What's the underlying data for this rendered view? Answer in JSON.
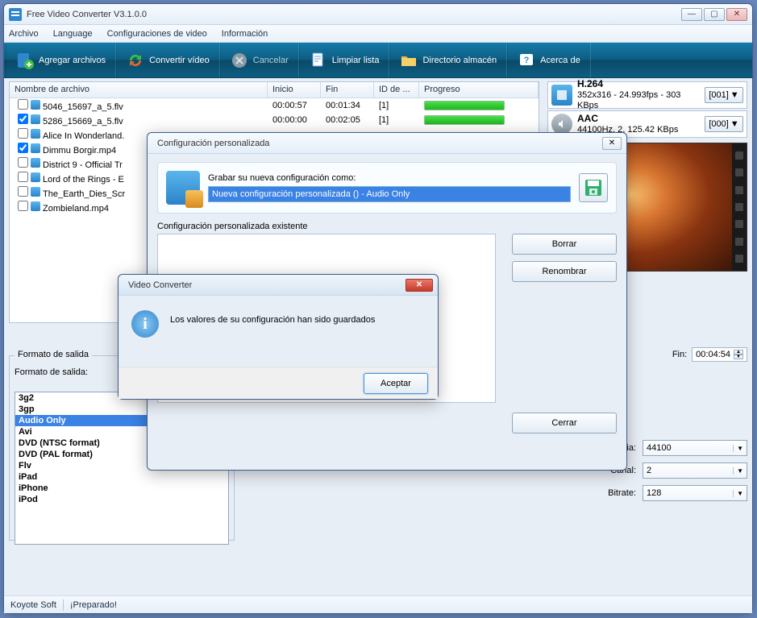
{
  "window": {
    "title": "Free Video Converter V3.1.0.0"
  },
  "menubar": {
    "items": [
      "Archivo",
      "Language",
      "Configuraciones de video",
      "Información"
    ]
  },
  "toolbar": {
    "add": "Agregar archivos",
    "convert": "Convertir vídeo",
    "cancel": "Cancelar",
    "clear": "Limpiar lista",
    "dir": "Directorio almacén",
    "about": "Acerca de"
  },
  "filelist": {
    "headers": {
      "name": "Nombre de archivo",
      "start": "Inicio",
      "end": "Fin",
      "id": "ID de ...",
      "progress": "Progreso"
    },
    "rows": [
      {
        "checked": false,
        "name": "5046_15697_a_5.flv",
        "start": "00:00:57",
        "end": "00:01:34",
        "id": "[1]",
        "progress": true
      },
      {
        "checked": true,
        "name": "5286_15669_a_5.flv",
        "start": "00:00:00",
        "end": "00:02:05",
        "id": "[1]",
        "progress": true
      },
      {
        "checked": false,
        "name": "Alice In Wonderland."
      },
      {
        "checked": true,
        "name": "Dimmu Borgir.mp4"
      },
      {
        "checked": false,
        "name": "District 9 - Official Tr"
      },
      {
        "checked": false,
        "name": "Lord of the Rings - E"
      },
      {
        "checked": false,
        "name": "The_Earth_Dies_Scr"
      },
      {
        "checked": false,
        "name": "Zombieland.mp4"
      }
    ]
  },
  "codec": {
    "video": {
      "title": "H.264",
      "detail": "352x316 - 24.993fps - 303 KBps",
      "btn": "[001]"
    },
    "audio": {
      "title": "AAC",
      "detail": "44100Hz, 2, 125.42 KBps",
      "btn": "[000]"
    }
  },
  "time": {
    "label": "Fin:",
    "value": "00:04:54"
  },
  "format": {
    "tab": "Formato de salida",
    "label": "Formato de salida:",
    "items": [
      "3g2",
      "3gp",
      "Audio Only",
      "Avi",
      "DVD (NTSC format)",
      "DVD (PAL format)",
      "Flv",
      "iPad",
      "iPhone",
      "iPod"
    ],
    "selected": "Audio Only"
  },
  "audioset": {
    "freq": {
      "label": "Frecuencia:",
      "value": "44100"
    },
    "chan": {
      "label": "Canal:",
      "value": "2"
    },
    "bitrate": {
      "label": "Bitrate:",
      "value": "128"
    }
  },
  "status": {
    "vendor": "Koyote Soft",
    "msg": "¡Preparado!"
  },
  "dlg_config": {
    "title": "Configuración personalizada",
    "save_label": "Grabar su nueva configuración como:",
    "input_value": "Nueva configuración personalizada () - Audio Only",
    "existing_label": "Configuración personalizada existente",
    "btn_delete": "Borrar",
    "btn_rename": "Renombrar",
    "btn_close": "Cerrar"
  },
  "dlg_alert": {
    "title": "Video Converter",
    "message": "Los valores de su configuración han sido guardados",
    "btn_ok": "Aceptar"
  }
}
